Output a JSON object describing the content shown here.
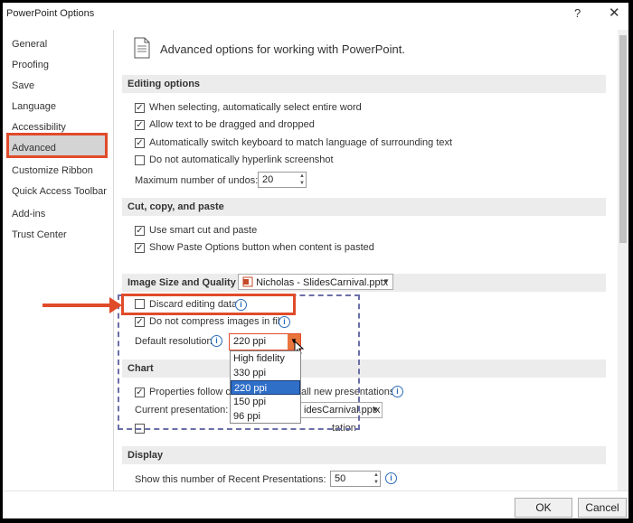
{
  "window": {
    "title": "PowerPoint Options",
    "help": "?",
    "close": "✕"
  },
  "sidebar": {
    "items": [
      {
        "label": "General"
      },
      {
        "label": "Proofing"
      },
      {
        "label": "Save"
      },
      {
        "label": "Language"
      },
      {
        "label": "Accessibility"
      },
      {
        "label": "Advanced"
      },
      {
        "label": "Customize Ribbon"
      },
      {
        "label": "Quick Access Toolbar"
      },
      {
        "label": "Add-ins"
      },
      {
        "label": "Trust Center"
      }
    ],
    "active": "Advanced"
  },
  "main": {
    "heading": "Advanced options for working with PowerPoint.",
    "editing": {
      "title": "Editing options",
      "opt1": "When selecting, automatically select entire word",
      "opt2": "Allow text to be dragged and dropped",
      "opt3": "Automatically switch keyboard to match language of surrounding text",
      "opt4": "Do not automatically hyperlink screenshot",
      "undos_label": "Maximum number of undos:",
      "undos_value": "20"
    },
    "ccp": {
      "title": "Cut, copy, and paste",
      "opt1": "Use smart cut and paste",
      "opt2": "Show Paste Options button when content is pasted"
    },
    "image": {
      "title": "Image Size and Quality",
      "file": "Nicholas - SlidesCarnival.pptx",
      "discard": "Discard editing data",
      "compress": "Do not compress images in file",
      "resolution_label": "Default resolution:",
      "resolution_value": "220 ppi",
      "options": [
        "High fidelity",
        "330 ppi",
        "220 ppi",
        "150 ppi",
        "96 ppi"
      ],
      "selected_option": "220 ppi"
    },
    "chart": {
      "title": "Chart",
      "opt1_left": "Properties follow ch",
      "opt1_right": "all new presentations",
      "current_label": "Current presentation:",
      "current_value_fragment": "idesCarnival.pptx",
      "partial_text": "tation"
    },
    "display": {
      "title": "Display",
      "recent_label": "Show this number of Recent Presentations:",
      "recent_value": "50"
    }
  },
  "footer": {
    "ok": "OK",
    "cancel": "Cancel"
  },
  "colors": {
    "highlight": "#e04b2a",
    "selection": "#2f6fc8",
    "info": "#2b6cb8"
  }
}
